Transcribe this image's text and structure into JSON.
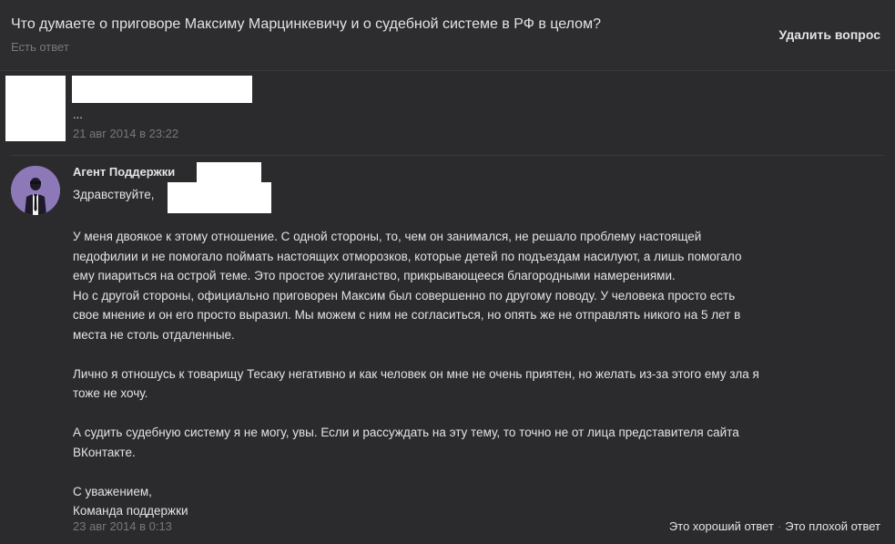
{
  "question": {
    "title": "Что думаете о приговоре Максиму Марцинкевичу и о судебной системе в РФ в целом?",
    "status": "Есть ответ",
    "delete_label": "Удалить вопрос"
  },
  "user_message": {
    "text": "...",
    "date": "21 авг 2014 в 23:22"
  },
  "agent_message": {
    "name": "Агент Поддержки",
    "greeting": "Здравствуйте,",
    "paragraphs": [
      {
        "lines": [
          "У меня двоякое к этому отношение. С одной стороны, то, чем он занимался, не решало проблему настоящей",
          "педофилии и не помогало поймать настоящих отморозков, которые детей по подъездам насилуют, а лишь помогало",
          "ему пиариться на острой теме. Это простое хулиганство, прикрывающееся благородными намерениями.",
          "Но с другой стороны, официально приговорен Максим был совершенно по другому поводу. У человека просто есть",
          "свое мнение и он его просто выразил. Мы можем с ним не согласиться, но опять же не отправлять никого на 5 лет в",
          "места не столь отдаленные."
        ]
      },
      {
        "lines": [
          "Лично я отношусь к товарищу Тесаку негативно и как человек он мне не очень приятен, но желать из-за этого ему зла я",
          "тоже не хочу."
        ]
      },
      {
        "lines": [
          "А судить судебную систему я не могу, увы. Если и рассуждать на эту тему, то точно не от лица представителя сайта",
          "ВКонтакте."
        ]
      },
      {
        "lines": [
          "С уважением,",
          "Команда поддержки"
        ]
      }
    ],
    "date": "23 авг 2014 в 0:13",
    "good_answer_label": "Это хороший ответ",
    "separator": "·",
    "bad_answer_label": "Это плохой ответ"
  },
  "colors": {
    "background": "#222224",
    "header_bg": "#2d2d30",
    "panel_bg": "#2b2b2e",
    "text": "#e1e3e6",
    "muted_text": "#76787a",
    "avatar_bg": "#8d78b8",
    "redaction": "#ffffff"
  },
  "icons": {
    "agent_avatar": "agent-in-suit-icon"
  }
}
